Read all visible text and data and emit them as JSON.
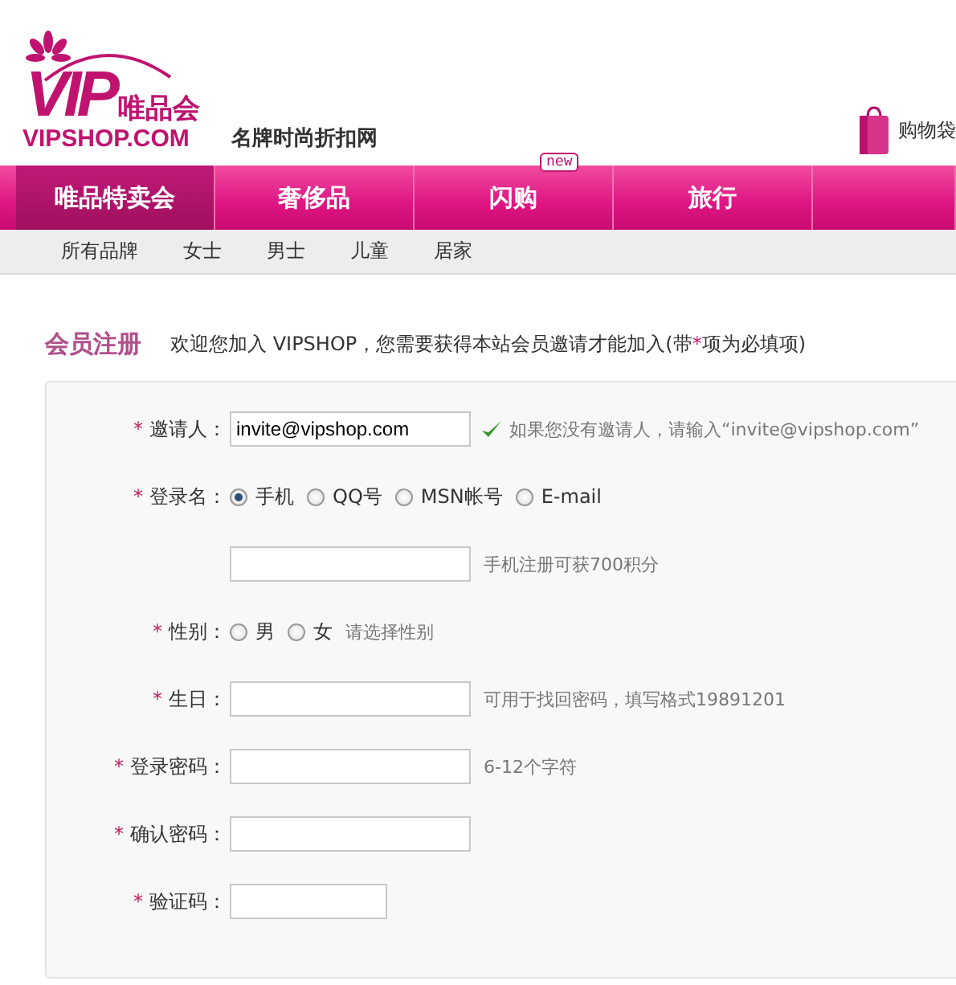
{
  "header": {
    "logo_mark": "VIP",
    "logo_name": "唯品会",
    "logo_domain": "VIPSHOP.COM",
    "tagline": "名牌时尚折扣网",
    "cart": "购物袋"
  },
  "nav": [
    {
      "label": "唯品特卖会",
      "selected": true
    },
    {
      "label": "奢侈品",
      "selected": false
    },
    {
      "label": "闪购",
      "selected": false,
      "badge": "new"
    },
    {
      "label": "旅行",
      "selected": false
    }
  ],
  "subnav": [
    "所有品牌",
    "女士",
    "男士",
    "儿童",
    "居家"
  ],
  "title": "会员注册",
  "intro": {
    "before": "欢迎您加入 VIPSHOP，您需要获得本站会员邀请才能加入(带",
    "marker": "*",
    "after": "项为必填项)"
  },
  "form": [
    {
      "kind": "input",
      "required": true,
      "label": "邀请人：",
      "value": "invite@vipshop.com",
      "valid": true,
      "hint": "如果您没有邀请人，请输入“invite@vipshop.com”"
    },
    {
      "kind": "radio",
      "required": true,
      "label": "登录名：",
      "options": [
        {
          "label": "手机",
          "selected": true
        },
        {
          "label": "QQ号",
          "selected": false
        },
        {
          "label": "MSN帐号",
          "selected": false
        },
        {
          "label": "E-mail",
          "selected": false
        }
      ]
    },
    {
      "kind": "input",
      "hint": "手机注册可获700积分"
    },
    {
      "kind": "radio",
      "required": true,
      "label": "性别：",
      "options": [
        {
          "label": "男",
          "selected": false
        },
        {
          "label": "女",
          "selected": false
        }
      ],
      "hint": "请选择性别"
    },
    {
      "kind": "input",
      "required": true,
      "label": "生日：",
      "hint": "可用于找回密码，填写格式19891201"
    },
    {
      "kind": "input",
      "required": true,
      "label": "登录密码：",
      "hint": "6-12个字符"
    },
    {
      "kind": "input",
      "required": true,
      "label": "确认密码："
    },
    {
      "kind": "short_input",
      "required": true,
      "label": "验证码："
    }
  ]
}
